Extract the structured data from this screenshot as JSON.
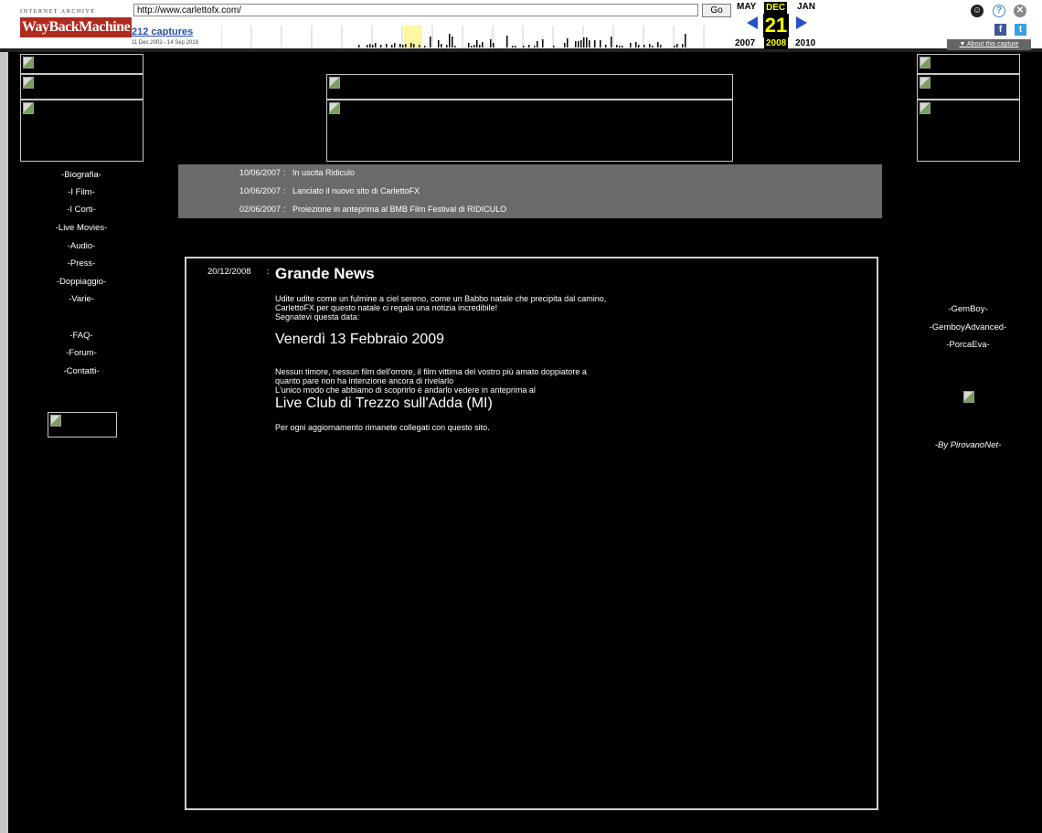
{
  "wayback": {
    "logo_top": "INTERNET ARCHIVE",
    "logo": "WayBackMachine",
    "url": "http://www.carlettofx.com/",
    "go_label": "Go",
    "captures": "212 captures",
    "range": "11 Dec 2002 - 14 Sep 2018",
    "cal": {
      "prev_month": "MAY",
      "cur_month": "DEC",
      "next_month": "JAN",
      "day": "21",
      "prev_year": "2007",
      "cur_year": "2008",
      "next_year": "2010"
    },
    "about": "▼ About this capture",
    "icons": [
      "user-icon",
      "help-icon",
      "close-icon",
      "facebook-icon",
      "twitter-icon"
    ]
  },
  "left_nav": [
    "-Biografia-",
    "-I Film-",
    "-I Corti-",
    "-Live Movies-",
    "-Audio-",
    "-Press-",
    "-Doppiaggio-",
    "-Varie-",
    "-FAQ-",
    "-Forum-",
    "-Contatti-"
  ],
  "right_nav": [
    "-GemBoy-",
    "-GemboyAdvanced-",
    "-PorcaEva-"
  ],
  "right_credit": "-By PirovanoNet-",
  "news": [
    {
      "date": "10/06/2007",
      "sep": ":",
      "text": "In uscita Ridiculo"
    },
    {
      "date": "10/06/2007",
      "sep": ":",
      "text": "Lanciato il nuovo sito di CarlettoFX"
    },
    {
      "date": "02/06/2007",
      "sep": ":",
      "text": "Proiezione in anteprima al BMB Film Festival di RIDICULO"
    }
  ],
  "article": {
    "date": "20/12/2008",
    "sep": ":",
    "title": "Grande News",
    "p1_lines": [
      "Udite udite come un fulmine a ciel sereno, come un Babbo natale che precipita dal camino,",
      "CarlettoFX per questo natale ci regala una notizia incredibile!",
      "Segnatevi questa data:"
    ],
    "event_date": "Venerdì 13 Febbraio 2009",
    "p2_lines": [
      "Nessun timore, nessun film dell'orrore, il film vittima del vostro più amato doppiatore a",
      "quanto pare non ha intenzione ancora di rivelarlo",
      "L'unico modo che abbiamo di scoprirlo è andarlo vedere in anteprima al"
    ],
    "venue": "Live Club di Trezzo sull'Adda (MI)",
    "closing": "Per ogni aggiornamento rimanete collegati con questo sito."
  }
}
